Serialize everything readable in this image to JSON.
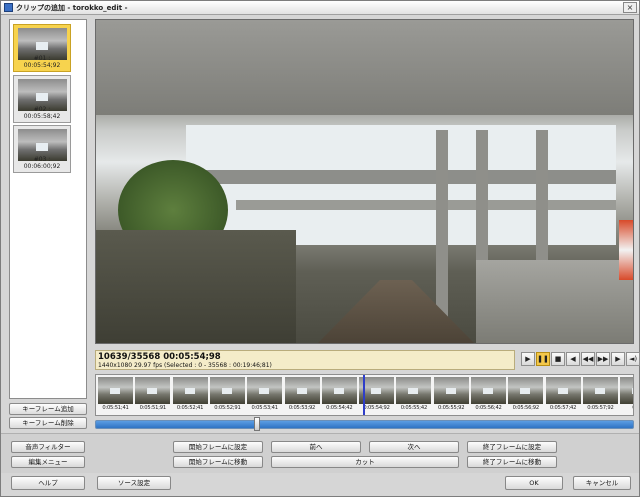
{
  "window": {
    "title": "クリップの追加 - torokko_edit -"
  },
  "clips": [
    {
      "label": "#01 : 00:05:54;92",
      "selected": true
    },
    {
      "label": "#02 : 00:05:58;42",
      "selected": false
    },
    {
      "label": "#03 : 00:06:00;92",
      "selected": false
    }
  ],
  "left_buttons": {
    "add_keyframe": "キーフレーム追加",
    "delete_keyframe": "キーフレーム削除"
  },
  "info": {
    "frame_time": "10639/35568  00:05:54;98",
    "details": "1440x1080 29.97 fps  (Selected : 0 - 35568 : 00:19:46;81)"
  },
  "playback_icons": [
    "play-icon",
    "pause-icon",
    "stop-icon",
    "step-back-icon",
    "rewind-icon",
    "fast-forward-icon",
    "step-forward-icon",
    "volume-icon"
  ],
  "playback_glyphs": [
    "▶",
    "❚❚",
    "■",
    "◀",
    "◀◀",
    "▶▶",
    "▶",
    "◄)"
  ],
  "filmstrip": [
    "0:05:51;41",
    "0:05:51;91",
    "0:05:52;41",
    "0:05:52;91",
    "0:05:53;41",
    "0:05:53;92",
    "0:05:54;42",
    "0:05:54;92",
    "0:05:55;42",
    "0:05:55;92",
    "0:05:56;42",
    "0:05:56;92",
    "0:05:57;42",
    "0:05:57;92",
    "0:05"
  ],
  "timeline": {
    "position_fraction": 0.3
  },
  "actions": {
    "audio_filter": "音声フィルター",
    "edit_menu": "編集メニュー",
    "set_start_frame": "開始フレームに設定",
    "goto_start_frame": "開始フレームに移動",
    "prev": "前へ",
    "next": "次へ",
    "cut": "カット",
    "set_end_frame": "終了フレームに設定",
    "goto_end_frame": "終了フレームに移動"
  },
  "footer": {
    "help": "ヘルプ",
    "source_settings": "ソース設定",
    "ok": "OK",
    "cancel": "キャンセル"
  }
}
